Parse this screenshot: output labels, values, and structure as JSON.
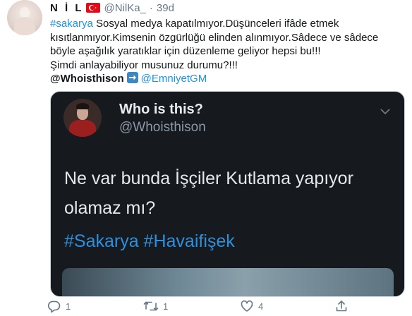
{
  "author": {
    "display_name": "N İ L",
    "handle": "@NilKa_",
    "separator": "·",
    "time": "39d"
  },
  "tweet": {
    "lines": [
      {
        "hashtag": "#sakarya",
        "text": " Sosyal medya kapatılmıyor.Düşünceleri ifâde etmek"
      },
      {
        "text": "kısıtlanmıyor.Kimsenin özgürlüğü elinden alınmıyor.Sâdece ve sâdece"
      },
      {
        "text": "böyle aşağılık yaratıklar için düzenleme geliyor hepsi bu!!!"
      },
      {
        "text": "Şimdi anlayabiliyor musunuz durumu?!!!"
      }
    ],
    "mention_from": "@Whoisthison",
    "mention_to": "@EmniyetGM"
  },
  "media": {
    "name": "Who is this?",
    "handle": "@Whoisthison",
    "text_lines": [
      "Ne var bunda İşçiler Kutlama yapıyor",
      "olamaz mı?"
    ],
    "hashtags": "#Sakarya #Havaifişek"
  },
  "actions": {
    "reply_count": "1",
    "retweet_count": "1",
    "like_count": "4"
  },
  "colors": {
    "link": "#1b95e0",
    "muted": "#657786",
    "media_bg": "#16191d"
  },
  "icons": [
    "avatar",
    "turkey-flag-icon",
    "right-arrow-emoji-icon",
    "chevron-down-icon",
    "reply-icon",
    "retweet-icon",
    "like-icon",
    "share-icon"
  ]
}
